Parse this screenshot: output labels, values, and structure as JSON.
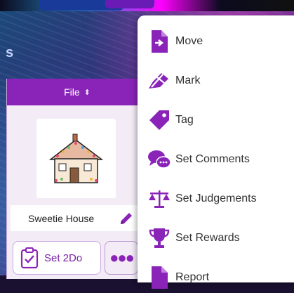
{
  "card": {
    "header_label": "File",
    "item_name": "Sweetie House",
    "set2do_label": "Set 2Do"
  },
  "menu": {
    "items": [
      {
        "label": "Move",
        "icon": "file-move-icon"
      },
      {
        "label": "Mark",
        "icon": "mark-icon"
      },
      {
        "label": "Tag",
        "icon": "tag-icon"
      },
      {
        "label": "Set Comments",
        "icon": "comments-icon"
      },
      {
        "label": "Set Judgements",
        "icon": "scales-icon"
      },
      {
        "label": "Set Rewards",
        "icon": "trophy-icon"
      },
      {
        "label": "Report",
        "icon": "report-icon"
      }
    ]
  },
  "colors": {
    "accent": "#8a24b8",
    "menu_bg": "#ffffff"
  }
}
